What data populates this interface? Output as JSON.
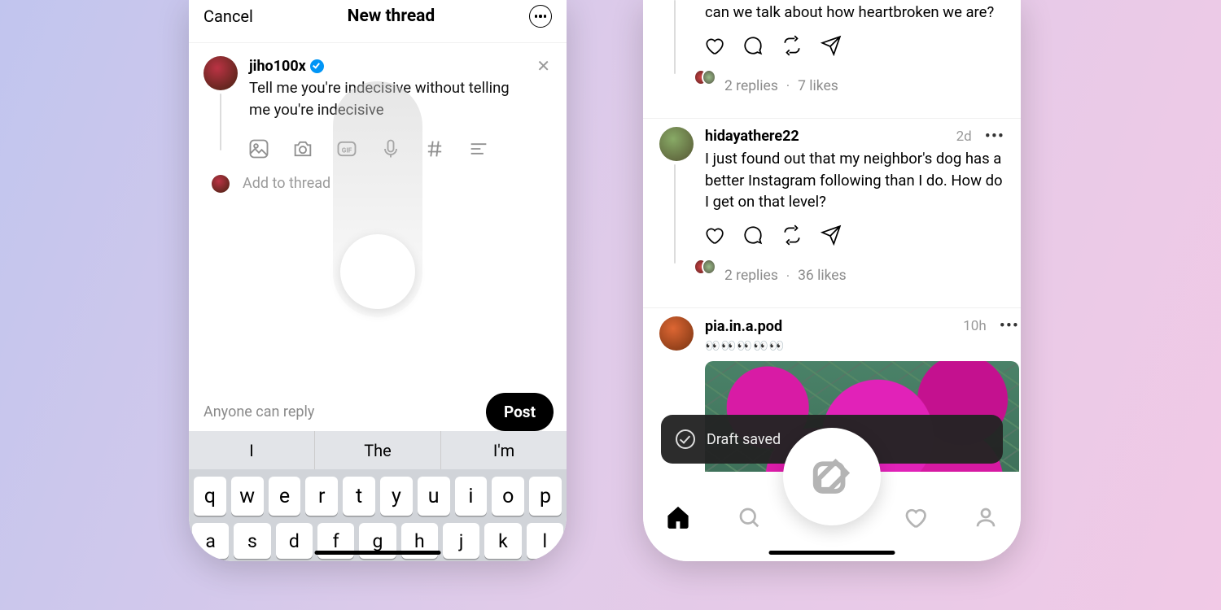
{
  "composer": {
    "cancel": "Cancel",
    "title": "New thread",
    "username": "jiho100x",
    "draft_text": "Tell me you're indecisive without telling me you're indecisive",
    "add_to_thread": "Add to thread",
    "reply_scope": "Anyone can reply",
    "post_label": "Post",
    "suggestions": [
      "I",
      "The",
      "I'm"
    ],
    "keys_row1": [
      "q",
      "w",
      "e",
      "r",
      "t",
      "y",
      "u",
      "i",
      "o",
      "p"
    ],
    "keys_row2": [
      "a",
      "s",
      "d",
      "f",
      "g",
      "h",
      "j",
      "k",
      "l"
    ]
  },
  "feed": {
    "posts": [
      {
        "text": "can we talk about how heartbroken we are?",
        "replies": "2 replies",
        "likes": "7 likes"
      },
      {
        "username": "hidayathere22",
        "time": "2d",
        "text": "I just found out that my neighbor's dog has a better Instagram following than I do. How do I get on that level?",
        "replies": "2 replies",
        "likes": "36 likes"
      },
      {
        "username": "pia.in.a.pod",
        "time": "10h",
        "emoji_row": "👀👀👀👀👀"
      }
    ],
    "toast": "Draft saved"
  }
}
